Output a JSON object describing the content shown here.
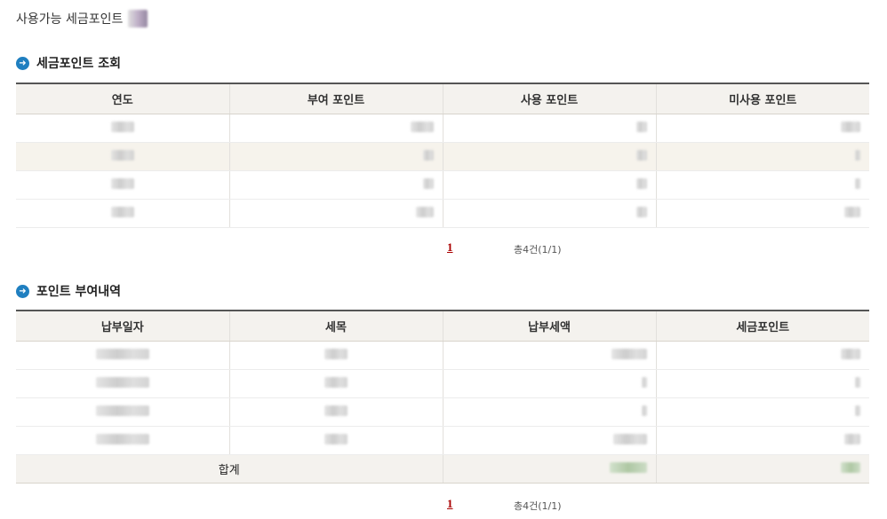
{
  "available": {
    "label": "사용가능 세금포인트"
  },
  "section1": {
    "title": "세금포인트 조회",
    "headers": [
      "연도",
      "부여 포인트",
      "사용 포인트",
      "미사용 포인트"
    ],
    "pager": {
      "page": "1",
      "total": "총4건(1/1)"
    }
  },
  "section2": {
    "title": "포인트 부여내역",
    "headers": [
      "납부일자",
      "세목",
      "납부세액",
      "세금포인트"
    ],
    "sum_label": "합계",
    "pager": {
      "page": "1",
      "total": "총4건(1/1)"
    }
  },
  "colors": {
    "bullet": "#1f7fc0",
    "header_bg": "#f4f2ee",
    "alt_row_bg": "#f6f3ec",
    "page_link": "#aa0000"
  },
  "icons": {
    "bullet": "arrow-right-circle-icon"
  }
}
